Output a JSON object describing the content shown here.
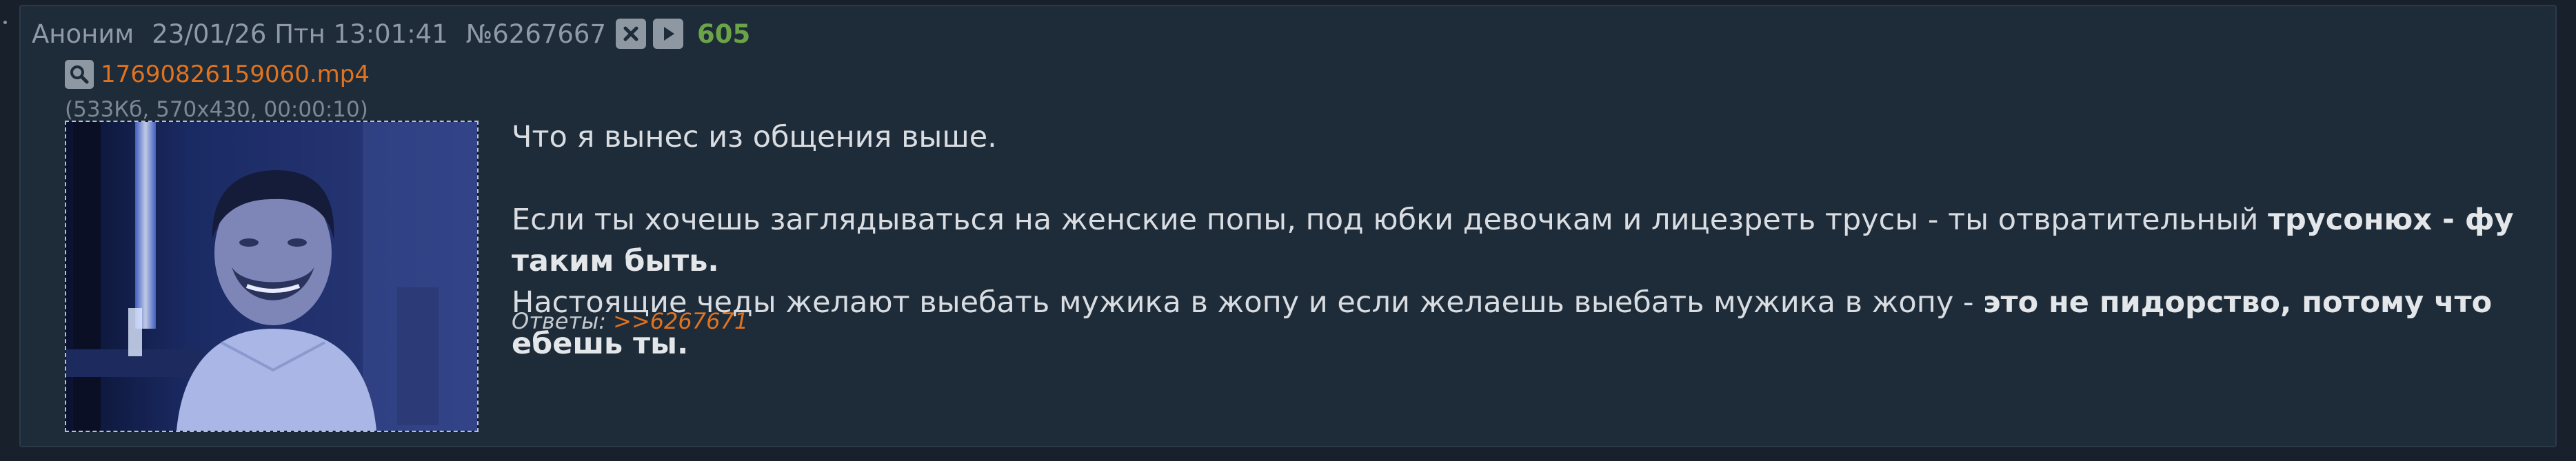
{
  "post": {
    "author": "Аноним",
    "datetime": "23/01/26 Птн 13:01:41",
    "number": "№6267667",
    "count": "605",
    "icons": {
      "close": "close-x-icon",
      "play": "play-icon",
      "search": "search-icon"
    }
  },
  "file": {
    "name": "17690826159060.mp4",
    "info": "(533Кб, 570x430, 00:00:10)"
  },
  "message": {
    "line1": "Что я вынес из общения выше.",
    "line2_text": "Если ты хочешь заглядываться на женские попы, под юбки девочкам и лицезреть трусы - ты отвратительный ",
    "line2_bold": "трусонюх - фу таким быть.",
    "line3_text": "Настоящие чеды желают выебать мужика в жопу и если желаешь выебать мужика в жопу - ",
    "line3_bold": "это не пидорство, потому что ебешь ты."
  },
  "replies": {
    "label": "Ответы:",
    "link": ">>6267671"
  },
  "colors": {
    "background": "#17202b",
    "post_bg": "#1e2b38",
    "link": "#e0731f",
    "count": "#6ba348",
    "text": "#d9dde2"
  }
}
